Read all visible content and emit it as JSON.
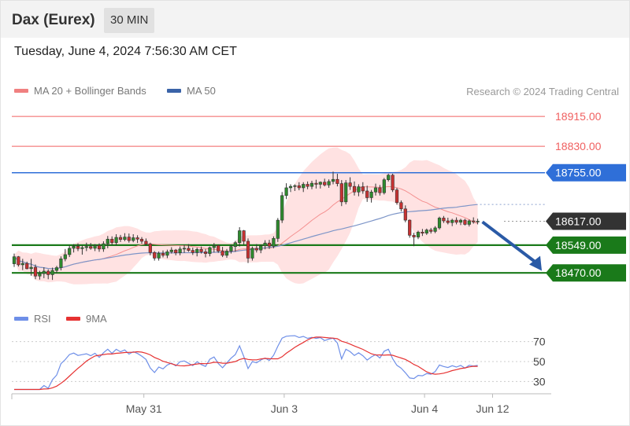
{
  "header": {
    "title": "Dax (Eurex)",
    "interval": "30 MIN"
  },
  "datetime": "Tuesday, June 4, 2024 7:56:30 AM CET",
  "credit": "Research © 2024 Trading Central",
  "legend_main": [
    {
      "label": "MA 20 + Bollinger Bands",
      "color": "#f08080"
    },
    {
      "label": "MA 50",
      "color": "#3a63a8"
    }
  ],
  "legend_rsi": [
    {
      "label": "RSI",
      "color": "#6e8fe8"
    },
    {
      "label": "9MA",
      "color": "#e63232"
    }
  ],
  "chart_data": {
    "type": "candlestick",
    "price_range": [
      18390,
      18960
    ],
    "levels": [
      {
        "label": "18915.00",
        "value": 18915,
        "kind": "resistance",
        "color": "#f06060"
      },
      {
        "label": "18830.00",
        "value": 18830,
        "kind": "resistance",
        "color": "#f06060"
      },
      {
        "label": "18755.00",
        "value": 18755,
        "kind": "pivot",
        "color": "#2f6fd8"
      },
      {
        "label": "18617.00",
        "value": 18617,
        "kind": "last",
        "color": "#333333"
      },
      {
        "label": "18549.00",
        "value": 18549,
        "kind": "support",
        "color": "#1a7a1a"
      },
      {
        "label": "18470.00",
        "value": 18470,
        "kind": "support",
        "color": "#1a7a1a"
      }
    ],
    "forecast_arrow": {
      "from": 18615,
      "to": 18485
    },
    "candles": [
      [
        18496,
        18525,
        18487,
        18516
      ],
      [
        18516,
        18518,
        18488,
        18493
      ],
      [
        18493,
        18510,
        18478,
        18497
      ],
      [
        18497,
        18502,
        18480,
        18482
      ],
      [
        18482,
        18510,
        18462,
        18486
      ],
      [
        18486,
        18494,
        18452,
        18461
      ],
      [
        18461,
        18476,
        18451,
        18468
      ],
      [
        18468,
        18486,
        18455,
        18475
      ],
      [
        18475,
        18480,
        18452,
        18465
      ],
      [
        18465,
        18485,
        18450,
        18477
      ],
      [
        18477,
        18490,
        18470,
        18485
      ],
      [
        18485,
        18517,
        18477,
        18510
      ],
      [
        18510,
        18538,
        18503,
        18522
      ],
      [
        18522,
        18548,
        18515,
        18540
      ],
      [
        18540,
        18552,
        18528,
        18546
      ],
      [
        18546,
        18554,
        18532,
        18539
      ],
      [
        18539,
        18548,
        18522,
        18542
      ],
      [
        18542,
        18556,
        18532,
        18545
      ],
      [
        18545,
        18555,
        18536,
        18540
      ],
      [
        18540,
        18552,
        18532,
        18548
      ],
      [
        18548,
        18554,
        18530,
        18538
      ],
      [
        18538,
        18560,
        18530,
        18553
      ],
      [
        18553,
        18575,
        18540,
        18566
      ],
      [
        18566,
        18574,
        18549,
        18556
      ],
      [
        18556,
        18580,
        18548,
        18571
      ],
      [
        18571,
        18578,
        18558,
        18565
      ],
      [
        18565,
        18583,
        18560,
        18572
      ],
      [
        18572,
        18582,
        18556,
        18562
      ],
      [
        18562,
        18580,
        18557,
        18570
      ],
      [
        18570,
        18577,
        18555,
        18566
      ],
      [
        18566,
        18572,
        18553,
        18560
      ],
      [
        18560,
        18568,
        18547,
        18552
      ],
      [
        18552,
        18556,
        18520,
        18528
      ],
      [
        18528,
        18532,
        18505,
        18512
      ],
      [
        18512,
        18531,
        18505,
        18526
      ],
      [
        18526,
        18534,
        18514,
        18520
      ],
      [
        18520,
        18536,
        18512,
        18530
      ],
      [
        18530,
        18543,
        18525,
        18535
      ],
      [
        18535,
        18538,
        18520,
        18527
      ],
      [
        18527,
        18545,
        18520,
        18538
      ],
      [
        18538,
        18550,
        18527,
        18540
      ],
      [
        18540,
        18552,
        18530,
        18534
      ],
      [
        18534,
        18542,
        18521,
        18528
      ],
      [
        18528,
        18542,
        18517,
        18537
      ],
      [
        18537,
        18545,
        18525,
        18530
      ],
      [
        18530,
        18538,
        18514,
        18525
      ],
      [
        18525,
        18545,
        18517,
        18542
      ],
      [
        18542,
        18555,
        18528,
        18548
      ],
      [
        18548,
        18550,
        18527,
        18532
      ],
      [
        18532,
        18544,
        18515,
        18520
      ],
      [
        18520,
        18538,
        18513,
        18532
      ],
      [
        18532,
        18550,
        18525,
        18545
      ],
      [
        18545,
        18561,
        18530,
        18556
      ],
      [
        18556,
        18600,
        18545,
        18590
      ],
      [
        18590,
        18592,
        18550,
        18560
      ],
      [
        18560,
        18568,
        18498,
        18512
      ],
      [
        18512,
        18545,
        18505,
        18540
      ],
      [
        18540,
        18552,
        18528,
        18535
      ],
      [
        18535,
        18550,
        18526,
        18547
      ],
      [
        18547,
        18563,
        18537,
        18555
      ],
      [
        18555,
        18564,
        18538,
        18546
      ],
      [
        18546,
        18574,
        18540,
        18568
      ],
      [
        18568,
        18626,
        18558,
        18620
      ],
      [
        18620,
        18700,
        18612,
        18690
      ],
      [
        18690,
        18725,
        18680,
        18712
      ],
      [
        18712,
        18722,
        18700,
        18716
      ],
      [
        18716,
        18722,
        18703,
        18718
      ],
      [
        18718,
        18728,
        18705,
        18712
      ],
      [
        18712,
        18728,
        18700,
        18722
      ],
      [
        18722,
        18730,
        18708,
        18716
      ],
      [
        18716,
        18732,
        18708,
        18725
      ],
      [
        18725,
        18735,
        18710,
        18722
      ],
      [
        18722,
        18730,
        18710,
        18728
      ],
      [
        18728,
        18738,
        18716,
        18720
      ],
      [
        18720,
        18736,
        18712,
        18730
      ],
      [
        18730,
        18758,
        18722,
        18736
      ],
      [
        18736,
        18752,
        18716,
        18724
      ],
      [
        18724,
        18734,
        18660,
        18672
      ],
      [
        18672,
        18734,
        18665,
        18726
      ],
      [
        18726,
        18742,
        18706,
        18716
      ],
      [
        18716,
        18730,
        18690,
        18700
      ],
      [
        18700,
        18722,
        18688,
        18715
      ],
      [
        18715,
        18728,
        18695,
        18703
      ],
      [
        18703,
        18718,
        18672,
        18684
      ],
      [
        18684,
        18706,
        18670,
        18700
      ],
      [
        18700,
        18724,
        18690,
        18712
      ],
      [
        18712,
        18720,
        18690,
        18698
      ],
      [
        18698,
        18740,
        18693,
        18735
      ],
      [
        18735,
        18752,
        18730,
        18748
      ],
      [
        18748,
        18752,
        18700,
        18706
      ],
      [
        18706,
        18712,
        18664,
        18670
      ],
      [
        18670,
        18676,
        18645,
        18652
      ],
      [
        18652,
        18662,
        18614,
        18620
      ],
      [
        18620,
        18622,
        18570,
        18577
      ],
      [
        18577,
        18584,
        18546,
        18572
      ],
      [
        18572,
        18590,
        18566,
        18586
      ],
      [
        18586,
        18595,
        18575,
        18583
      ],
      [
        18583,
        18596,
        18578,
        18592
      ],
      [
        18592,
        18598,
        18582,
        18588
      ],
      [
        18588,
        18603,
        18583,
        18598
      ],
      [
        18598,
        18630,
        18593,
        18626
      ],
      [
        18626,
        18632,
        18612,
        18618
      ],
      [
        18618,
        18627,
        18608,
        18613
      ],
      [
        18613,
        18624,
        18603,
        18620
      ],
      [
        18620,
        18628,
        18608,
        18614
      ],
      [
        18614,
        18624,
        18606,
        18620
      ],
      [
        18620,
        18624,
        18605,
        18608
      ],
      [
        18608,
        18622,
        18602,
        18618
      ],
      [
        18618,
        18628,
        18610,
        18615
      ],
      [
        18615,
        18624,
        18608,
        18617
      ]
    ],
    "x_ticks": [
      {
        "label": "May 31",
        "index": 30.5
      },
      {
        "label": "Jun 3",
        "index": 63.5
      },
      {
        "label": "Jun 4",
        "index": 96.5
      },
      {
        "label": "Jun 12",
        "index": 112.5
      }
    ],
    "rsi": {
      "range": [
        20,
        80
      ],
      "levels": [
        {
          "label": "70",
          "value": 70
        },
        {
          "label": "50",
          "value": 50
        },
        {
          "label": "30",
          "value": 30
        }
      ]
    }
  }
}
